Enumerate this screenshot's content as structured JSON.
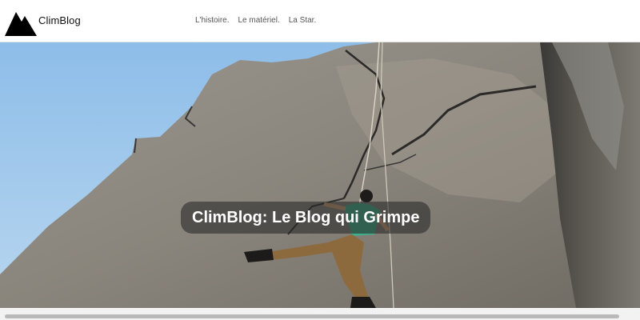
{
  "header": {
    "brand": "ClimBlog",
    "logo_icon": "mountain-icon",
    "nav": [
      "L'histoire.",
      "Le matériel.",
      "La Star."
    ]
  },
  "hero": {
    "title": "ClimBlog: Le Blog qui Grimpe",
    "image": "rock-climber-photo"
  },
  "colors": {
    "sky": "#9fc6ea",
    "rock": "#8f8b82",
    "title_bg": "#2a2a2a"
  }
}
